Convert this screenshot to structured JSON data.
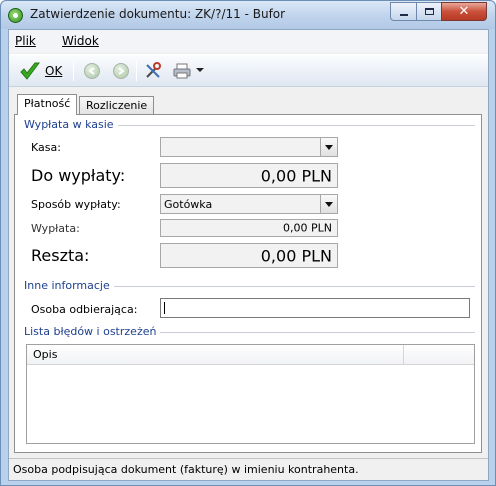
{
  "window": {
    "title": "Zatwierdzenie dokumentu: ZK/?/11 - Bufor",
    "close_glyph": "✕"
  },
  "menu": {
    "items": [
      {
        "label": "Plik"
      },
      {
        "label": "Widok"
      }
    ]
  },
  "toolbar": {
    "ok_label": "OK",
    "icons": [
      "ok-check-icon",
      "back-icon",
      "forward-icon",
      "tools-icon",
      "printer-icon",
      "dropdown-arrow-icon"
    ]
  },
  "tabs": [
    {
      "label": "Płatność",
      "active": true
    },
    {
      "label": "Rozliczenie",
      "active": false
    }
  ],
  "payment": {
    "section_title": "Wypłata w kasie",
    "kasa_label": "Kasa:",
    "kasa_value": "",
    "do_wyplaty_label": "Do wypłaty:",
    "do_wyplaty_value": "0,00 PLN",
    "sposob_label": "Sposób wypłaty:",
    "sposob_value": "Gotówka",
    "wyplata_label": "Wypłata:",
    "wyplata_value": "0,00 PLN",
    "reszta_label": "Reszta:",
    "reszta_value": "0,00 PLN"
  },
  "other": {
    "section_title": "Inne informacje",
    "osoba_label": "Osoba odbierająca:",
    "osoba_value": ""
  },
  "errors": {
    "section_title": "Lista błędów i ostrzeżeń",
    "columns": [
      "Opis",
      ""
    ]
  },
  "status": {
    "text": "Osoba podpisująca dokument (fakturę) w imieniu kontrahenta."
  },
  "colors": {
    "group_title": "#1e3f8f",
    "ok_check": "#3aa824"
  }
}
